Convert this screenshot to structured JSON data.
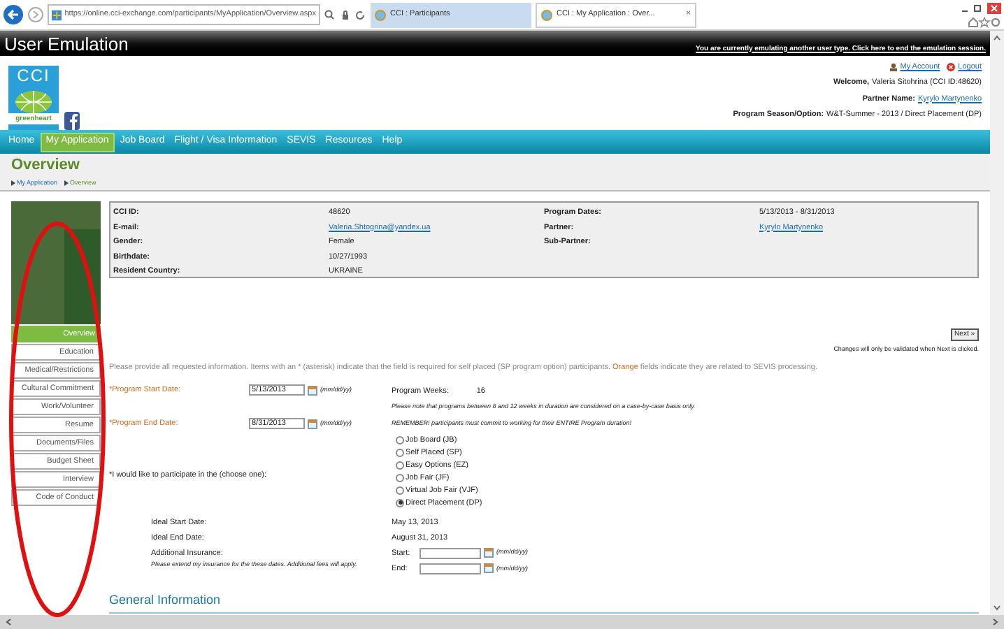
{
  "browser": {
    "url": "https://online.cci-exchange.com/participants/MyApplication/Overview.aspx",
    "tabs": [
      {
        "title": "CCI : Participants",
        "selected": false
      },
      {
        "title": "CCI : My Application : Over...",
        "selected": true,
        "close": "×"
      }
    ]
  },
  "emulation_bar": {
    "title": "User Emulation",
    "message": "You are currently emulating another user type. Click here to end the emulation session."
  },
  "header": {
    "logo": {
      "text": "CCI",
      "tagline": "greenheart"
    },
    "links": [
      "My Account",
      "Logout"
    ],
    "info": [
      {
        "label": "Welcome,",
        "value": "Valeria Sitohrina (CCI ID:48620)",
        "kind": "text"
      },
      {
        "label": "Partner Name:",
        "value": "Kyrylo Martynenko",
        "kind": "link"
      },
      {
        "label": "Program Season/Option:",
        "value": "W&T-Summer - 2013 / Direct Placement (DP)",
        "kind": "text"
      }
    ]
  },
  "nav": [
    {
      "label": "Home",
      "selected": false
    },
    {
      "label": "My Application",
      "selected": true
    },
    {
      "label": "Job Board",
      "selected": false
    },
    {
      "label": "Flight / Visa Information",
      "selected": false
    },
    {
      "label": "SEVIS",
      "selected": false
    },
    {
      "label": "Resources",
      "selected": false
    },
    {
      "label": "Help",
      "selected": false
    }
  ],
  "page_title": "Overview",
  "breadcrumbs": [
    "My Application",
    "Overview"
  ],
  "sidebar": [
    {
      "label": "Overview",
      "selected": true
    },
    {
      "label": "Education",
      "selected": false
    },
    {
      "label": "Medical/Restrictions",
      "selected": false
    },
    {
      "label": "Cultural Commitment",
      "selected": false
    },
    {
      "label": "Work/Volunteer",
      "selected": false
    },
    {
      "label": "Resume",
      "selected": false
    },
    {
      "label": "Documents/Files",
      "selected": false
    },
    {
      "label": "Budget Sheet",
      "selected": false
    },
    {
      "label": "Interview",
      "selected": false
    },
    {
      "label": "Code of Conduct",
      "selected": false
    }
  ],
  "profile": {
    "left": [
      {
        "label": "CCI ID:",
        "value": "48620",
        "kind": "text"
      },
      {
        "label": "E-mail:",
        "value": "Valeria.Shtogrina@yandex.ua",
        "kind": "link"
      },
      {
        "label": "Gender:",
        "value": "Female",
        "kind": "text"
      },
      {
        "label": "Birthdate:",
        "value": "10/27/1993",
        "kind": "text"
      },
      {
        "label": "Resident Country:",
        "value": "UKRAINE",
        "kind": "text"
      }
    ],
    "right": [
      {
        "label": "Program Dates:",
        "value": "5/13/2013 - 8/31/2013",
        "kind": "text"
      },
      {
        "label": "Partner:",
        "value": "Kyrylo Martynenko",
        "kind": "link"
      },
      {
        "label": "Sub-Partner:"
      }
    ]
  },
  "next_button": "Next »",
  "next_note": "Changes will only be validated when Next is clicked.",
  "instructions": {
    "before": "Please provide all requested information. Items with an * (asterisk) indicate that the field is required for self placed (SP program option) participants. ",
    "highlight": "Orange",
    "after": " fields indicate they are related to SEVIS processing."
  },
  "form": {
    "start_date": {
      "label": "*Program Start Date:",
      "value": "5/13/2013",
      "hint": "(mm/dd/yy)"
    },
    "weeks": {
      "label": "Program Weeks:",
      "value": "16",
      "note": "Please note that programs between 8 and 12 weeks in duration are considered on a case-by-case basis only."
    },
    "end_date": {
      "label": "*Program End Date:",
      "value": "8/31/2013",
      "hint": "(mm/dd/yy)"
    },
    "remember": "REMEMBER! participants must commit to working for their ENTIRE Program duration!",
    "choose_label": "*I would like to participate in the (choose one):",
    "options": [
      {
        "label": "Job Board (JB)",
        "selected": false
      },
      {
        "label": "Self Placed (SP)",
        "selected": false
      },
      {
        "label": "Easy Options (EZ)",
        "selected": false
      },
      {
        "label": "Job Fair (JF)",
        "selected": false
      },
      {
        "label": "Virtual Job Fair (VJF)",
        "selected": false
      },
      {
        "label": "Direct Placement (DP)",
        "selected": true
      }
    ],
    "ideal": [
      {
        "label": "Ideal Start Date:",
        "value": "May 13, 2013"
      },
      {
        "label": "Ideal End Date:",
        "value": "August 31, 2013"
      }
    ],
    "insurance": {
      "label": "Additional Insurance:",
      "note": "Please extend my insurance for the these dates. Additional fees will apply.",
      "fields": [
        {
          "label": "Start:",
          "hint": "(mm/dd/yy)"
        },
        {
          "label": "End:",
          "hint": "(mm/dd/yy)"
        }
      ]
    }
  },
  "section_heading": "General Information"
}
